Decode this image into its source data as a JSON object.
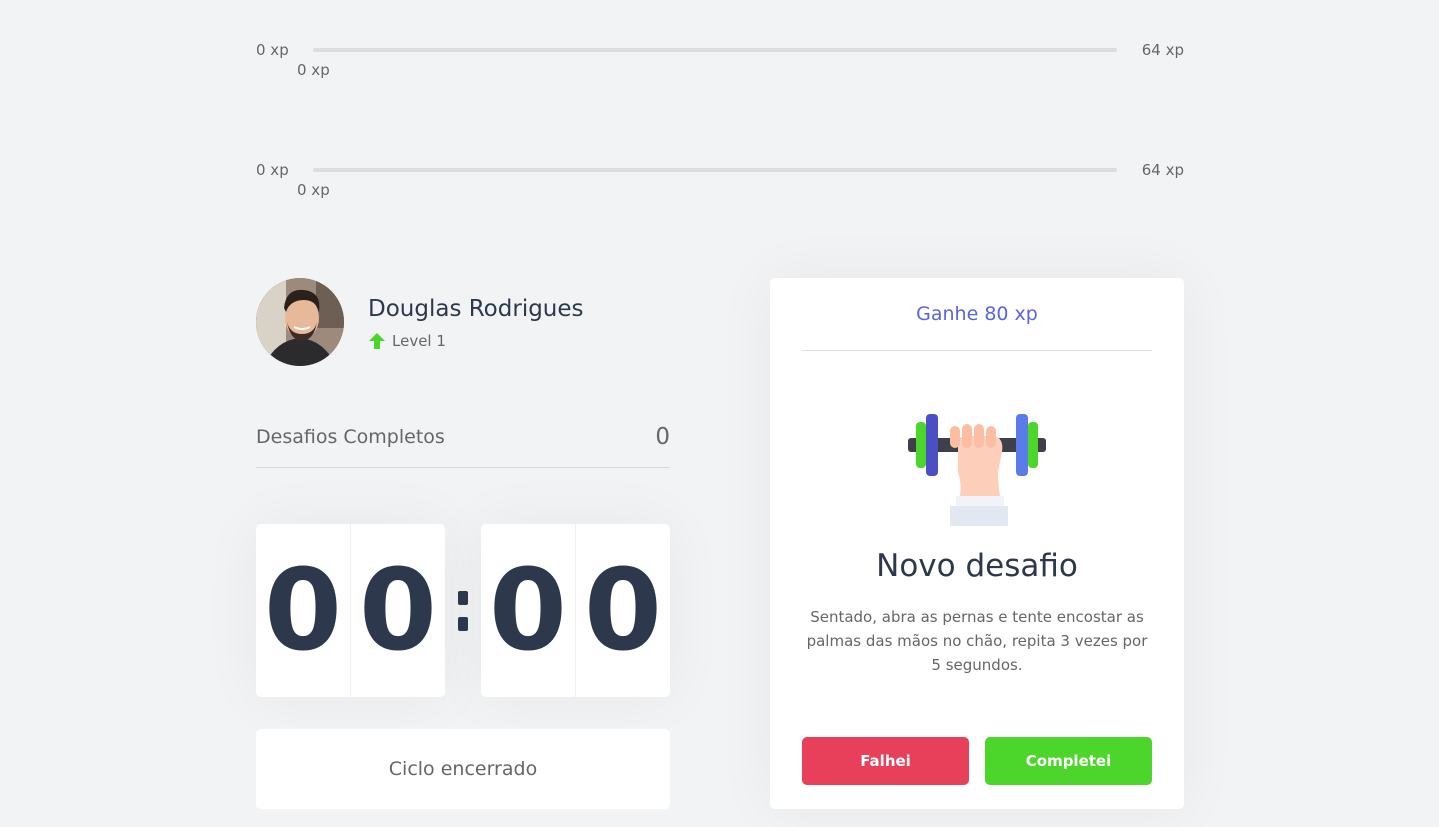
{
  "xp_bars": [
    {
      "min": "0 xp",
      "max": "64 xp",
      "current": "0 xp",
      "progress": 0
    },
    {
      "min": "0 xp",
      "max": "64 xp",
      "current": "0 xp",
      "progress": 0
    }
  ],
  "profile": {
    "name": "Douglas Rodrigues",
    "level": "Level 1",
    "level_icon": "level-up-arrow-icon"
  },
  "completed": {
    "label": "Desafios Completos",
    "count": "0"
  },
  "countdown": {
    "minute_left": "0",
    "minute_right": "0",
    "second_left": "0",
    "second_right": "0"
  },
  "cycle_button": "Ciclo encerrado",
  "challenge": {
    "header": "Ganhe 80 xp",
    "icon": "dumbbell-icon",
    "title": "Novo desafio",
    "description": "Sentado, abra as pernas e tente encostar as palmas das mãos no chão, repita 3 vezes por 5 segundos.",
    "fail_label": "Falhei",
    "done_label": "Completei"
  },
  "colors": {
    "accent": "#5965e0",
    "fail": "#e83f5b",
    "success": "#4cd62b",
    "title": "#2e384d"
  }
}
